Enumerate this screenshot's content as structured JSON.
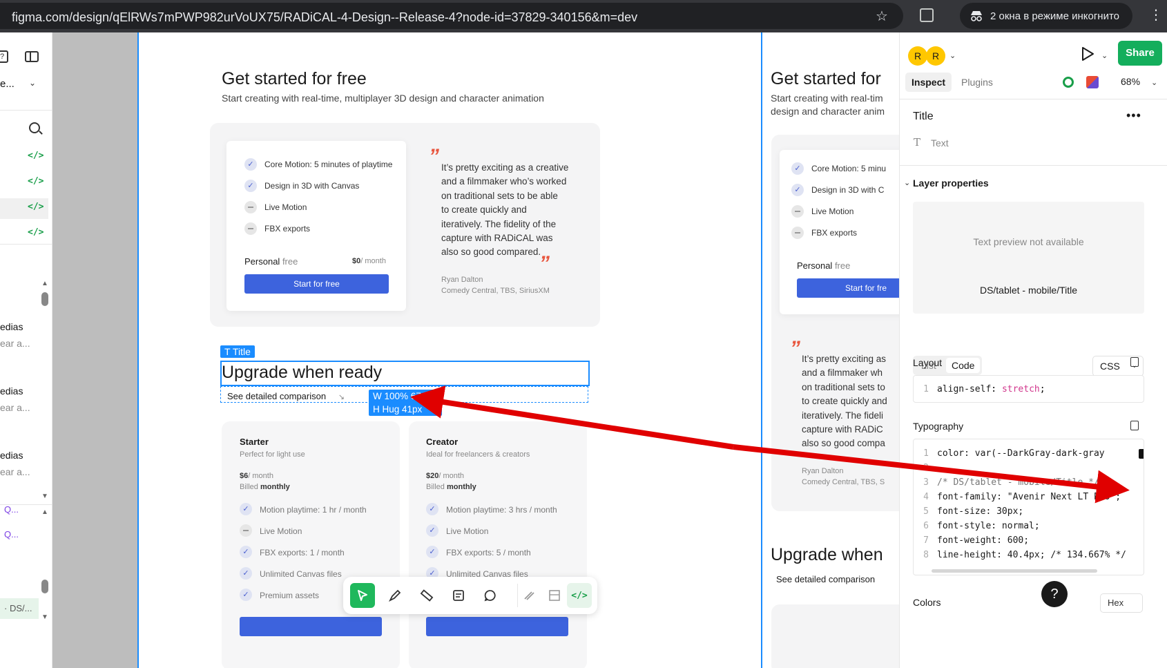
{
  "browser": {
    "url": "figma.com/design/qElRWs7mPWP982urVoUX75/RADiCAL-4-Design--Release-4?node-id=37829-340156&m=dev",
    "incognito_label": "2 окна в режиме инкогнито"
  },
  "left_panel": {
    "page_name": "e...",
    "items": [
      {
        "title": "edias",
        "sub": "ear a..."
      },
      {
        "title": "edias",
        "sub": "ear a..."
      },
      {
        "title": "edias",
        "sub": "ear a..."
      }
    ],
    "q_items": [
      "Q...",
      "Q..."
    ],
    "bottom_item": "· DS/..."
  },
  "canvas": {
    "hero_title": "Get started for free",
    "hero_subtitle": "Start creating with real-time, multiplayer 3D design and character animation",
    "free_features": [
      {
        "label": "Core Motion: 5 minutes of playtime",
        "included": true
      },
      {
        "label": "Design in 3D with Canvas",
        "included": true
      },
      {
        "label": "Live Motion",
        "included": false
      },
      {
        "label": "FBX exports",
        "included": false
      }
    ],
    "personal_label": "Personal",
    "personal_free": "free",
    "personal_price": "$0",
    "personal_period": "/ month",
    "start_free_button": "Start for free",
    "quote_open": "”",
    "quote_close": "”",
    "quote_lines": [
      "It’s pretty exciting as a creative",
      "and a filmmaker who’s worked",
      "on traditional sets to be able",
      "to create quickly and",
      "iteratively. The fidelity of the",
      "capture with RADiCAL was",
      "also so good compared."
    ],
    "quote_author": "Ryan Dalton",
    "quote_org": "Comedy Central, TBS, SiriusXM",
    "selection_tag": "T  Title",
    "upgrade_title": "Upgrade when ready",
    "comparison_link": "See detailed comparison",
    "comparison_arrow": "↘",
    "dim_w_label": "W 100%  676px",
    "dim_h_label": "H  Hug      41px",
    "plans": [
      {
        "name": "Starter",
        "desc": "Perfect for light use",
        "price": "$6",
        "period": "/ month",
        "billed": "Billed",
        "billed_freq": "monthly",
        "features": [
          {
            "label": "Motion playtime: 1 hr / month",
            "included": true
          },
          {
            "label": "Live Motion",
            "included": false
          },
          {
            "label": "FBX exports: 1  / month",
            "included": true
          },
          {
            "label": "Unlimited Canvas files",
            "included": true
          },
          {
            "label": "Premium assets",
            "included": true
          }
        ]
      },
      {
        "name": "Creator",
        "desc": "Ideal for freelancers & creators",
        "price": "$20",
        "period": "/ month",
        "billed": "Billed",
        "billed_freq": "monthly",
        "features": [
          {
            "label": "Motion playtime: 3 hrs / month",
            "included": true
          },
          {
            "label": "Live Motion",
            "included": true
          },
          {
            "label": "FBX exports: 5 / month",
            "included": true
          },
          {
            "label": "Unlimited Canvas files",
            "included": true
          }
        ]
      }
    ],
    "second_frame": {
      "hero_title": "Get started for",
      "hero_subtitle_1": "Start creating with real-tim",
      "hero_subtitle_2": "design and character anim",
      "features": [
        "Core Motion: 5 minu",
        "Design in 3D with C",
        "Live Motion",
        "FBX exports"
      ],
      "personal_label": "Personal",
      "personal_free": "free",
      "start_button": "Start for fre",
      "quote_lines": [
        "It’s pretty exciting as",
        "and a filmmaker wh",
        "on traditional sets to",
        "to create quickly and",
        "iteratively. The fideli",
        "capture with RADiC",
        "also so good compa"
      ],
      "author": "Ryan Dalton",
      "org": "Comedy Central, TBS, S",
      "upgrade_title": "Upgrade when",
      "comparison": "See detailed comparison"
    }
  },
  "toolbar": {
    "tools": [
      "move-tool",
      "pen-tool",
      "measure-tool",
      "annotate-tool",
      "comment-tool",
      "draw-tool",
      "component-tool",
      "code-tool"
    ]
  },
  "right_panel": {
    "avatars": [
      "R",
      "R"
    ],
    "share_label": "Share",
    "tabs": {
      "inspect": "Inspect",
      "plugins": "Plugins"
    },
    "zoom": "68%",
    "layer_title": "Title",
    "more": "•••",
    "layer_type_icon": "T",
    "layer_type": "Text",
    "layer_properties": "Layer properties",
    "preview_not_available": "Text preview not available",
    "style_name": "DS/tablet - mobile/Title",
    "view_list": "List",
    "view_code": "Code",
    "language": "CSS",
    "layout_label": "Layout",
    "layout_code": [
      {
        "n": "1",
        "prop": "align-self",
        "val": "stretch"
      }
    ],
    "typography_label": "Typography",
    "typography_code": [
      {
        "n": "1",
        "text": "color: var(--DarkGray-dark-gray"
      },
      {
        "n": "2",
        "text": ""
      },
      {
        "n": "3",
        "text": "/* DS/tablet - mobile/Title */"
      },
      {
        "n": "4",
        "text": "font-family: \"Avenir Next LT Pro\";"
      },
      {
        "n": "5",
        "text": "font-size: 30px;"
      },
      {
        "n": "6",
        "text": "font-style: normal;"
      },
      {
        "n": "7",
        "text": "font-weight: 600;"
      },
      {
        "n": "8",
        "text": "line-height: 40.4px; /* 134.667% */"
      }
    ],
    "colors_label": "Colors",
    "hex_label": "Hex",
    "help": "?"
  },
  "colors": {
    "accent_blue": "#1a8cff",
    "share_green": "#14ae5c",
    "button_blue": "#3d63dd",
    "arrow_red": "#e00000",
    "quote_red": "#e8553d"
  }
}
